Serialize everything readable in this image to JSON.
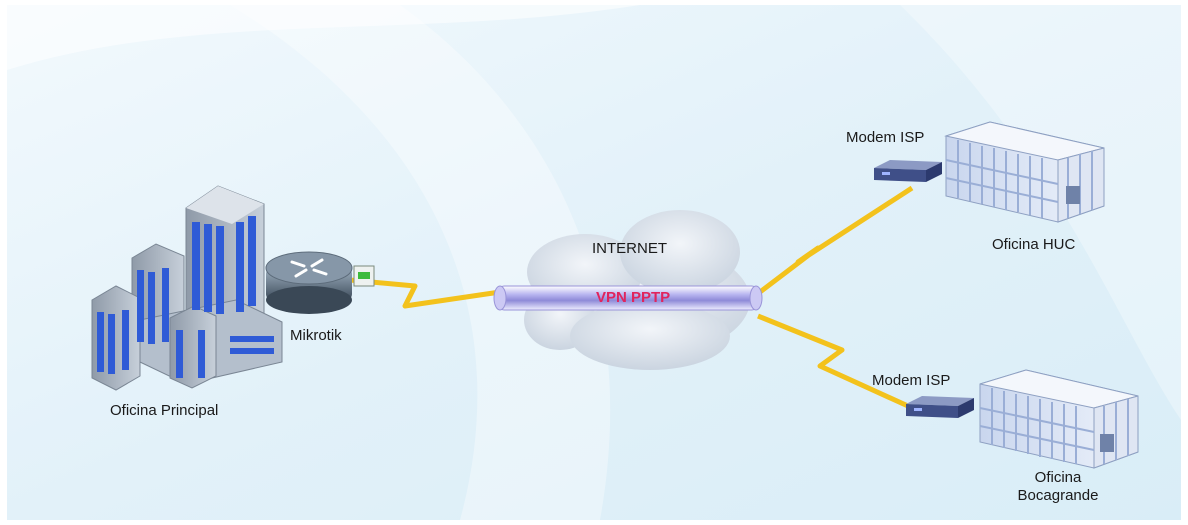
{
  "labels": {
    "main_office": "Oficina Principal",
    "router": "Mikrotik",
    "internet": "INTERNET",
    "vpn": "VPN PPTP",
    "modem_top": "Modem ISP",
    "office_huc": "Oficina HUC",
    "modem_bottom": "Modem ISP",
    "office_boca_line1": "Oficina",
    "office_boca_line2": "Bocagrande"
  },
  "colors": {
    "background": "#e6f3fa",
    "lightning": "#f3c21c",
    "vpn_text": "#e0245e",
    "cloud": "#d4dde8",
    "building_blue": "#2f5bd6",
    "router": "#4a5a6a",
    "modem": "#4a5a8f"
  }
}
